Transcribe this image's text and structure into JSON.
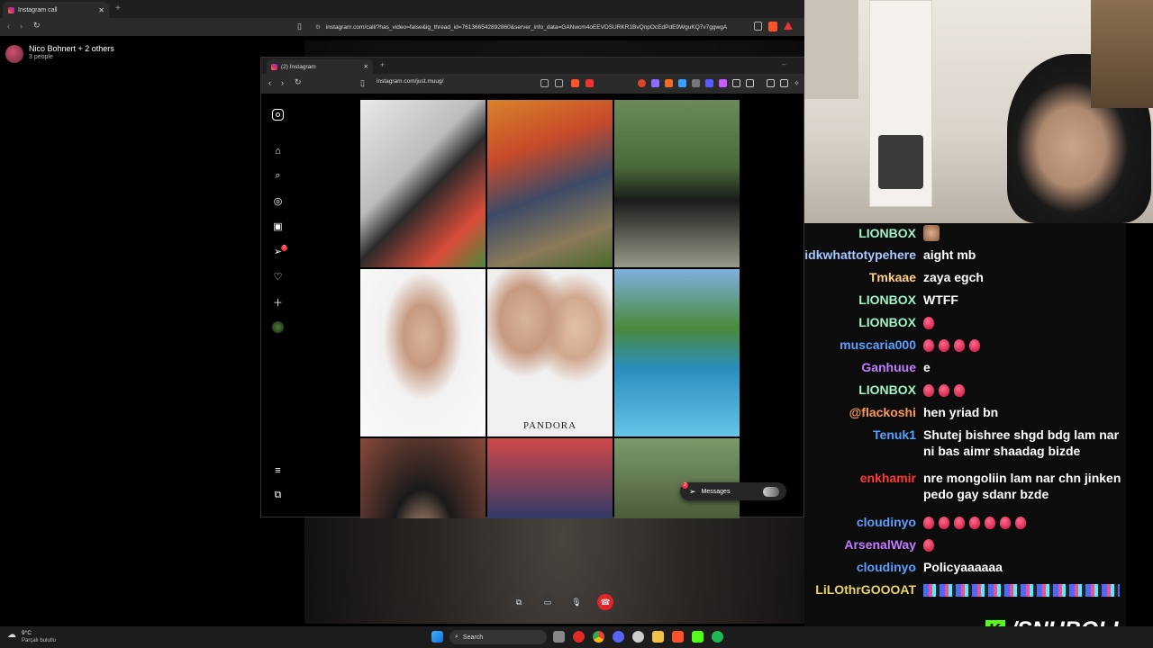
{
  "outer_browser": {
    "tab_title": "Instagram call",
    "url": "instagram.com/call/?has_video=false&ig_thread_id=761366542892860&server_info_data=GANwcm4oEEVDSURKR1BvQnpOcEdPdE9WguKQ7v7ggwgA"
  },
  "call": {
    "title": "Nico Bohnert + 2 others",
    "subtitle": "3 people"
  },
  "inner_browser": {
    "tab_title": "(2) Instagram",
    "url": "instagram.com/just.muug/"
  },
  "instagram": {
    "notification_count": "2",
    "messages_label": "Messages",
    "messages_badge": "2",
    "pandora_text": "PANDORA"
  },
  "chat": [
    {
      "user": "LIONBOX",
      "color": "#9df5c8",
      "msg": "",
      "emotes": 0,
      "face": true
    },
    {
      "user": "idkwhattotypehere",
      "color": "#a8c8ff",
      "msg": "aight mb",
      "emotes": 0
    },
    {
      "user": "Tmkaae",
      "color": "#ffd08a",
      "msg": "zaya egch",
      "emotes": 0
    },
    {
      "user": "LIONBOX",
      "color": "#9df5c8",
      "msg": "WTFF",
      "emotes": 0
    },
    {
      "user": "LIONBOX",
      "color": "#9df5c8",
      "msg": "",
      "emotes": 1
    },
    {
      "user": "muscaria000",
      "color": "#5aa0ff",
      "msg": "",
      "emotes": 4
    },
    {
      "user": "Ganhuue",
      "color": "#c07cff",
      "msg": "e",
      "emotes": 0
    },
    {
      "user": "LIONBOX",
      "color": "#9df5c8",
      "msg": "",
      "emotes": 3
    },
    {
      "user": "@flackoshi",
      "color": "#ff9a4a",
      "msg": "hen yriad bn",
      "emotes": 0
    },
    {
      "user": "Tenuk1",
      "color": "#5aa0ff",
      "msg": "Shutej bishree shgd bdg lam nar ni bas aimr shaadag bizde",
      "emotes": 0
    },
    {
      "user": "enkhamir",
      "color": "#ff3a3a",
      "msg": "nre mongoliin lam nar chn jinken pedo gay sdanr bzde",
      "emotes": 0
    },
    {
      "user": "cloudinyo",
      "color": "#5aa0ff",
      "msg": "",
      "emotes": 7
    },
    {
      "user": "ArsenalWay",
      "color": "#c07cff",
      "msg": "",
      "emotes": 1
    },
    {
      "user": "cloudinyo",
      "color": "#5aa0ff",
      "msg": "Policyaaaaaa",
      "emotes": 0
    },
    {
      "user": "LiLOthrGOOOAT",
      "color": "#e8d66a",
      "msg": "",
      "emotes": 0,
      "banner": true
    }
  ],
  "overlay": {
    "handle": "/SNUBOLI",
    "brand_color": "#53fc18"
  },
  "taskbar": {
    "weather_temp": "9°C",
    "weather_desc": "Parçalı bulutlu",
    "search_label": "Search"
  }
}
